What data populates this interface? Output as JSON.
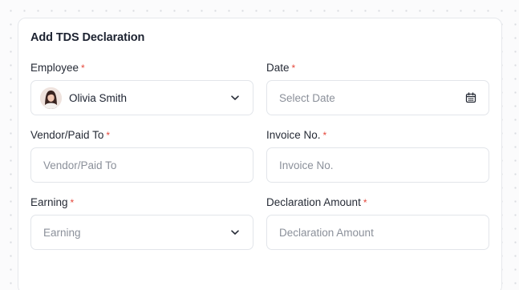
{
  "form": {
    "title": "Add TDS Declaration",
    "required_marker": "*",
    "employee": {
      "label": "Employee",
      "selected_value": "Olivia Smith",
      "icon": "chevron-down-icon"
    },
    "date": {
      "label": "Date",
      "placeholder": "Select Date",
      "icon": "calendar-icon"
    },
    "vendor": {
      "label": "Vendor/Paid To",
      "placeholder": "Vendor/Paid To"
    },
    "invoice": {
      "label": "Invoice No.",
      "placeholder": "Invoice No."
    },
    "earning": {
      "label": "Earning",
      "placeholder": "Earning",
      "icon": "chevron-down-icon"
    },
    "declaration_amount": {
      "label": "Declaration Amount",
      "placeholder": "Declaration Amount"
    }
  },
  "colors": {
    "required": "#e5483c",
    "placeholder": "#8b909a",
    "text": "#1c2230",
    "border": "#e2e5ea"
  }
}
